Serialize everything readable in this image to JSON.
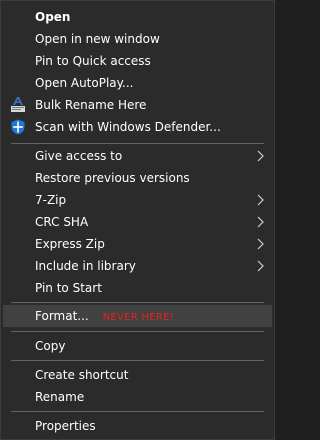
{
  "menu": {
    "items": [
      {
        "label": "Open"
      },
      {
        "label": "Open in new window"
      },
      {
        "label": "Pin to Quick access"
      },
      {
        "label": "Open AutoPlay..."
      },
      {
        "label": "Bulk Rename Here",
        "icon": "bulk-rename-icon"
      },
      {
        "label": "Scan with Windows Defender...",
        "icon": "windows-defender-shield-icon"
      },
      {
        "label": "Give access to",
        "submenu": true
      },
      {
        "label": "Restore previous versions"
      },
      {
        "label": "7-Zip",
        "submenu": true
      },
      {
        "label": "CRC SHA",
        "submenu": true
      },
      {
        "label": "Express Zip",
        "submenu": true
      },
      {
        "label": "Include in library",
        "submenu": true
      },
      {
        "label": "Pin to Start"
      },
      {
        "label": "Format...",
        "annotation": "NEVER HERE!"
      },
      {
        "label": "Copy"
      },
      {
        "label": "Create shortcut"
      },
      {
        "label": "Rename"
      },
      {
        "label": "Properties"
      }
    ]
  },
  "colors": {
    "menu_background": "#2b2b2b",
    "highlight_background": "#414141",
    "separator": "#646464",
    "text": "#ffffff",
    "annotation": "#e8231f",
    "defender_blue": "#1e78d7"
  }
}
